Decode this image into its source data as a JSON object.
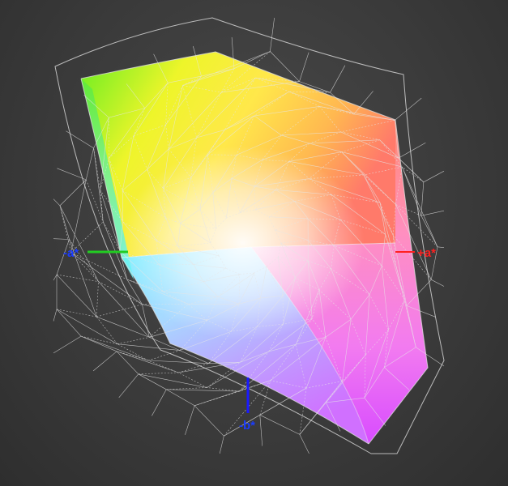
{
  "axes": {
    "neg_a": {
      "label": "-a*",
      "color": "#1a3cff",
      "line_color": "#22cc22"
    },
    "pos_a": {
      "label": "+a*",
      "color": "#ff2020",
      "line_color": "#ff2020"
    },
    "neg_b": {
      "label": "-b*",
      "color": "#1a3cff",
      "line_color": "#1a1aff"
    }
  },
  "colors": {
    "background": "#3a3a3a",
    "wireframe": "#e6e6e6"
  }
}
